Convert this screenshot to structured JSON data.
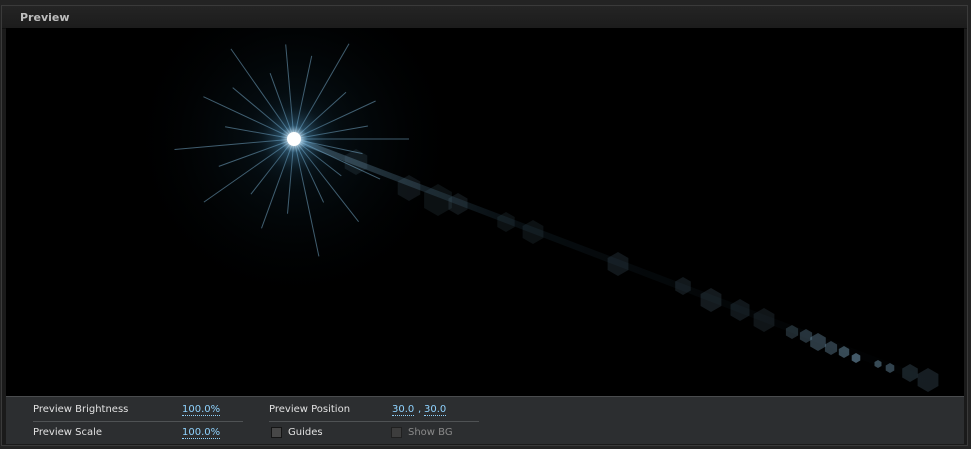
{
  "panel": {
    "title": "Preview"
  },
  "controls": {
    "brightness": {
      "label": "Preview Brightness",
      "value": "100.0%"
    },
    "scale": {
      "label": "Preview Scale",
      "value": "100.0%"
    },
    "position": {
      "label": "Preview Position",
      "x": "30.0",
      "separator": ",",
      "y": "30.0"
    },
    "guides": {
      "label": "Guides",
      "checked": false
    },
    "show_bg": {
      "label": "Show BG",
      "checked": false,
      "enabled": false
    }
  },
  "colors": {
    "value_link": "#8fd3ff",
    "flare_core": "#ffffff",
    "flare_glow": "#6fb6e6"
  }
}
